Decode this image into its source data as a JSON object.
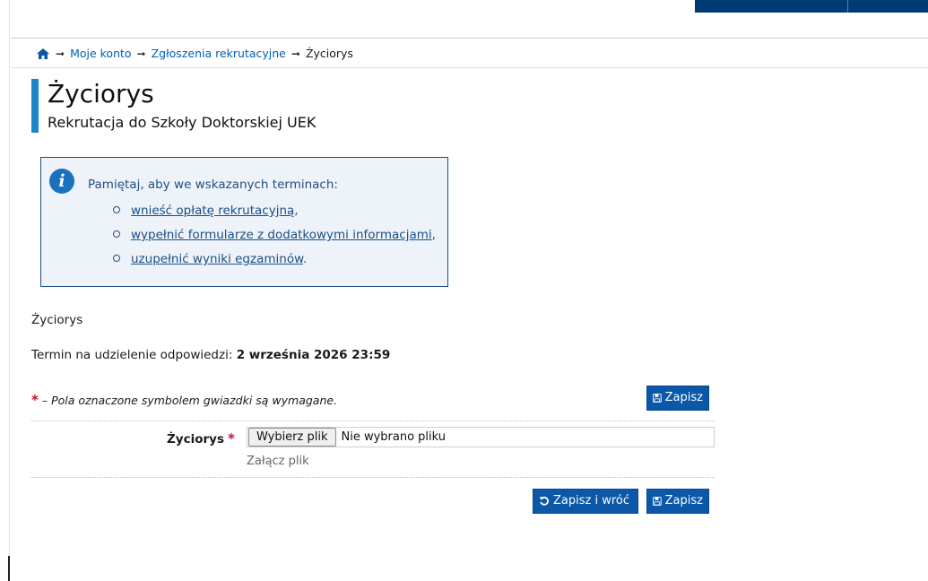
{
  "breadcrumb": {
    "home_icon": "home-icon",
    "arrow": "➞",
    "items": [
      "Moje konto",
      "Zgłoszenia rekrutacyjne",
      "Życiorys"
    ]
  },
  "page": {
    "title": "Życiorys",
    "subtitle": "Rekrutacja do Szkoły Doktorskiej UEK"
  },
  "info": {
    "icon": "info-icon",
    "lead": "Pamiętaj, aby we wskazanych terminach:",
    "items": [
      {
        "link": "wnieść opłatę rekrutacyjną",
        "suffix": ","
      },
      {
        "link": "wypełnić formularze z dodatkowymi informacjami",
        "suffix": ","
      },
      {
        "link": "uzupełnić wyniki egzaminów",
        "suffix": "."
      }
    ]
  },
  "section": {
    "label": "Życiorys",
    "deadline_label": "Termin na udzielenie odpowiedzi:",
    "deadline_value": "2 września 2026 23:59"
  },
  "form": {
    "required_star": "*",
    "required_note": "– Pola oznaczone symbolem gwiazdki są wymagane.",
    "field_label": "Życiorys",
    "file_button": "Wybierz plik",
    "file_status": "Nie wybrano pliku",
    "help_text": "Załącz plik"
  },
  "buttons": {
    "save": "Zapisz",
    "save_and_return": "Zapisz i wróć",
    "save_icon": "floppy-disk-icon",
    "return_icon": "undo-icon"
  },
  "colors": {
    "accent": "#1e86c8",
    "button": "#0b57a8",
    "link": "#0060b0",
    "required": "#c8102e",
    "info_bg": "#eef3f9"
  }
}
